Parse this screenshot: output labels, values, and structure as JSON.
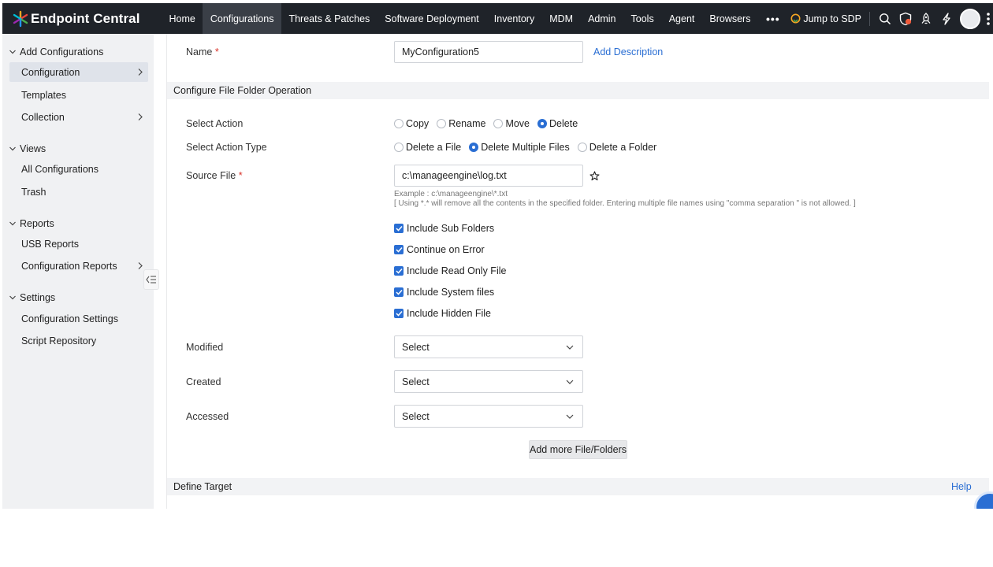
{
  "app": {
    "name": "Endpoint Central",
    "colors": {
      "topbar": "#1f2329",
      "accent": "#2a6ed3",
      "required": "#d9342b"
    }
  },
  "nav": {
    "items": [
      {
        "label": "Home"
      },
      {
        "label": "Configurations"
      },
      {
        "label": "Threats & Patches"
      },
      {
        "label": "Software Deployment"
      },
      {
        "label": "Inventory"
      },
      {
        "label": "MDM"
      },
      {
        "label": "Admin"
      },
      {
        "label": "Tools"
      },
      {
        "label": "Agent"
      },
      {
        "label": "Browsers"
      }
    ],
    "active": "Configurations",
    "more": "•••",
    "jump_label": "Jump to SDP",
    "icons": [
      "search-icon",
      "bug-shield-icon",
      "rocket-icon",
      "lightning-icon",
      "avatar",
      "app-grid-icon"
    ]
  },
  "sidebar": {
    "sections": [
      {
        "title": "Add Configurations",
        "items": [
          {
            "label": "Configuration",
            "has_arrow": true,
            "active": true
          },
          {
            "label": "Templates"
          },
          {
            "label": "Collection",
            "has_arrow": true
          }
        ]
      },
      {
        "title": "Views",
        "items": [
          {
            "label": "All Configurations"
          },
          {
            "label": "Trash"
          }
        ]
      },
      {
        "title": "Reports",
        "items": [
          {
            "label": "USB Reports"
          },
          {
            "label": "Configuration Reports",
            "has_arrow": true
          }
        ]
      },
      {
        "title": "Settings",
        "items": [
          {
            "label": "Configuration Settings"
          },
          {
            "label": "Script Repository"
          }
        ]
      }
    ]
  },
  "form": {
    "name_label": "Name",
    "required_mark": "*",
    "name_value": "MyConfiguration5",
    "add_description": "Add Description",
    "section_title": "Configure File Folder Operation",
    "select_action": {
      "label": "Select Action",
      "options": [
        "Copy",
        "Rename",
        "Move",
        "Delete"
      ],
      "selected": "Delete"
    },
    "select_action_type": {
      "label": "Select Action Type",
      "options": [
        "Delete a File",
        "Delete Multiple Files",
        "Delete a Folder"
      ],
      "selected": "Delete Multiple Files"
    },
    "source_file": {
      "label": "Source File",
      "value": "c:\\manageengine\\log.txt",
      "hint_example": "Example : c:\\manageengine\\*.txt",
      "hint_note": "[ Using *.* will remove all the contents in the specified folder. Entering multiple file names using \"comma separation \" is not allowed. ]"
    },
    "checkboxes": [
      {
        "label": "Include Sub Folders",
        "checked": true
      },
      {
        "label": "Continue on Error",
        "checked": true
      },
      {
        "label": "Include Read Only File",
        "checked": true
      },
      {
        "label": "Include System files",
        "checked": true
      },
      {
        "label": "Include Hidden File",
        "checked": true
      }
    ],
    "modified": {
      "label": "Modified",
      "value": "Select"
    },
    "created": {
      "label": "Created",
      "value": "Select"
    },
    "accessed": {
      "label": "Accessed",
      "value": "Select"
    },
    "add_more_button": "Add more File/Folders",
    "define_target": "Define Target",
    "help_link": "Help"
  }
}
